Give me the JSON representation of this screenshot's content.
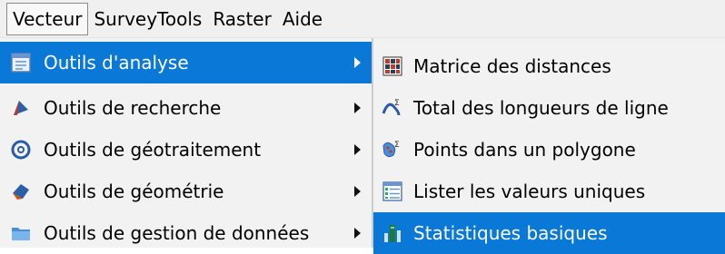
{
  "menubar": {
    "items": [
      "Vecteur",
      "SurveyTools",
      "Raster",
      "Aide"
    ]
  },
  "submenu_left": {
    "items": [
      {
        "label": "Outils d'analyse",
        "icon": "analysis-tools-icon"
      },
      {
        "label": "Outils de recherche",
        "icon": "research-tools-icon"
      },
      {
        "label": "Outils de géotraitement",
        "icon": "geoprocessing-tools-icon"
      },
      {
        "label": "Outils de géométrie",
        "icon": "geometry-tools-icon"
      },
      {
        "label": "Outils de gestion de données",
        "icon": "data-management-folder-icon"
      }
    ]
  },
  "submenu_right": {
    "items": [
      {
        "label": "Matrice des distances",
        "icon": "distance-matrix-icon"
      },
      {
        "label": "Total des longueurs de ligne",
        "icon": "line-length-sum-icon"
      },
      {
        "label": "Points dans un polygone",
        "icon": "points-in-polygon-icon"
      },
      {
        "label": "Lister les valeurs uniques",
        "icon": "unique-values-list-icon"
      },
      {
        "label": "Statistiques basiques",
        "icon": "basic-statistics-icon"
      }
    ]
  },
  "colors": {
    "highlight": "#0a78d7",
    "menu_background": "#f2f2f2"
  }
}
